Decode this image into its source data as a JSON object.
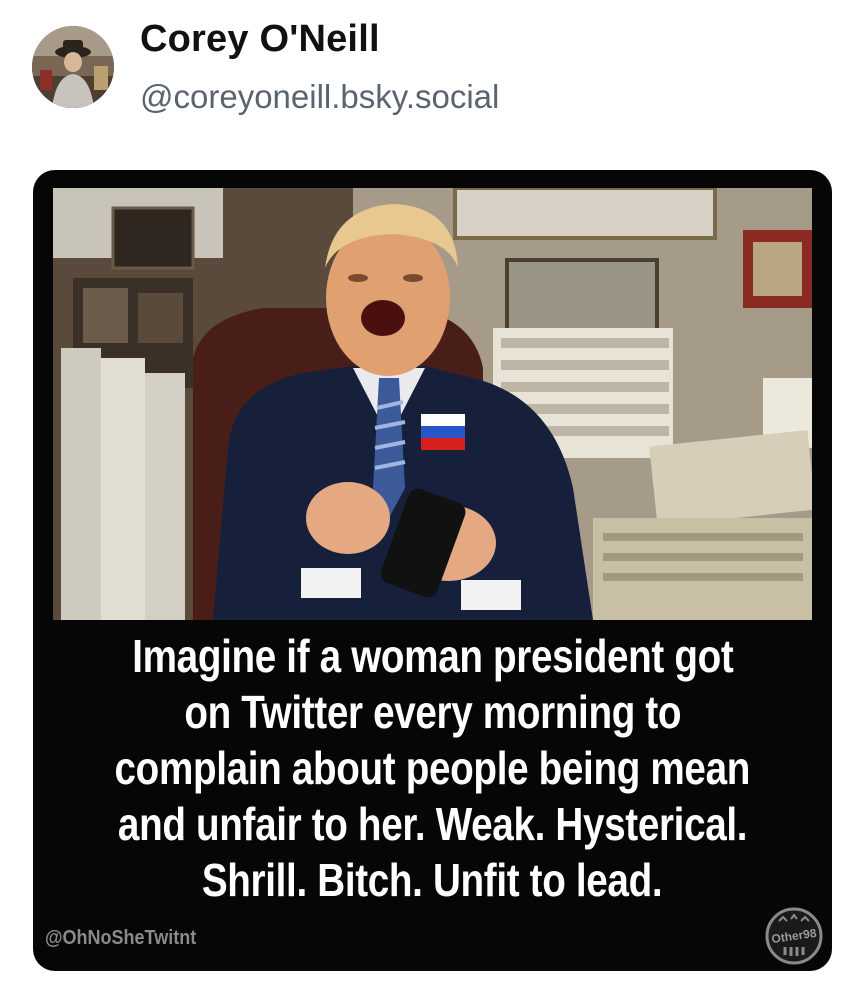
{
  "author": {
    "display_name": "Corey O'Neill",
    "handle": "@coreyoneill.bsky.social"
  },
  "image": {
    "caption_lines": [
      "Imagine if a woman president got",
      "on Twitter every morning to",
      "complain about people being mean",
      "and unfair to her. Weak. Hysterical.",
      "Shrill. Bitch. Unfit to lead."
    ],
    "watermark_handle": "@OhNoSheTwitnt",
    "badge_text": "Other98"
  }
}
